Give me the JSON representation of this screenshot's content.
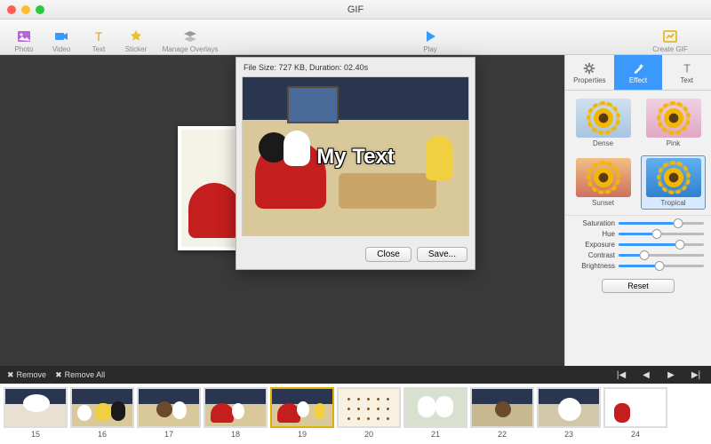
{
  "window": {
    "title": "GIF"
  },
  "toolbar": {
    "left": [
      {
        "id": "photo-tool",
        "label": "Photo",
        "icon": "photo"
      },
      {
        "id": "video-tool",
        "label": "Video",
        "icon": "video"
      },
      {
        "id": "text-tool",
        "label": "Text",
        "icon": "text"
      },
      {
        "id": "sticker-tool",
        "label": "Sticker",
        "icon": "sticker"
      },
      {
        "id": "manage-overlays-tool",
        "label": "Manage Overlays",
        "icon": "layers"
      }
    ],
    "center": {
      "id": "play-tool",
      "label": "Play",
      "icon": "play"
    },
    "right": [
      {
        "id": "create-gif-tool",
        "label": "Create GIF",
        "icon": "create"
      }
    ]
  },
  "popup": {
    "info_label": "File Size: 727 KB,  Duration: 02.40s",
    "overlay_text": "My Text",
    "close_label": "Close",
    "save_label": "Save..."
  },
  "side_panel": {
    "tabs": [
      {
        "id": "properties-tab",
        "label": "Properties",
        "active": false
      },
      {
        "id": "effect-tab",
        "label": "Effect",
        "active": true
      },
      {
        "id": "text-tab",
        "label": "Text",
        "active": false
      }
    ],
    "effects": [
      {
        "id": "effect-dense",
        "label": "Dense",
        "bg": "linear-gradient(#d0e0f0,#a8c4e0)",
        "selected": false
      },
      {
        "id": "effect-pink",
        "label": "Pink",
        "bg": "linear-gradient(#f0d0e0,#e0a8c4)",
        "selected": false
      },
      {
        "id": "effect-sunset",
        "label": "Sunset",
        "bg": "linear-gradient(#f0c080,#d07060)",
        "selected": false
      },
      {
        "id": "effect-tropical",
        "label": "Tropical",
        "bg": "linear-gradient(#60b0f0,#3080d0)",
        "selected": true
      }
    ],
    "sliders": [
      {
        "id": "saturation-slider",
        "label": "Saturation",
        "value": 70
      },
      {
        "id": "hue-slider",
        "label": "Hue",
        "value": 45
      },
      {
        "id": "exposure-slider",
        "label": "Exposure",
        "value": 72
      },
      {
        "id": "contrast-slider",
        "label": "Contrast",
        "value": 30
      },
      {
        "id": "brightness-slider",
        "label": "Brightness",
        "value": 48
      }
    ],
    "reset_label": "Reset"
  },
  "frames_bar": {
    "remove_label": "Remove",
    "remove_all_label": "Remove All"
  },
  "timeline": {
    "frames": [
      15,
      16,
      17,
      18,
      19,
      20,
      21,
      22,
      23,
      24
    ],
    "current": 19
  }
}
